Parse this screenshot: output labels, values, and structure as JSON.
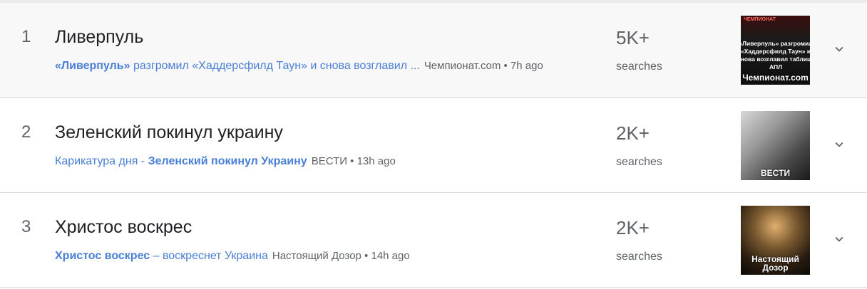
{
  "trends": [
    {
      "rank": "1",
      "title": "Ливерпуль",
      "link_bold": "«Ливерпуль»",
      "link_rest": " разгромил «Хаддерсфилд Таун» и снова возглавил ...",
      "source_time": "Чемпионат.com • 7h ago",
      "count": "5K+",
      "count_label": "searches",
      "thumb_caption": "Чемпионат.com",
      "thumb_small_top": "ЧЕМПИОНАТ",
      "thumb_small_text": "«Ливерпуль» разгромил «Хаддерсфилд Таун» и снова возглавил таблицу АПЛ"
    },
    {
      "rank": "2",
      "title": "Зеленский покинул украину",
      "link_pre": "Карикатура дня - ",
      "link_bold": "Зеленский покинул Украину",
      "source_time": "ВЕСТИ • 13h ago",
      "count": "2K+",
      "count_label": "searches",
      "thumb_caption": "ВЕСТИ"
    },
    {
      "rank": "3",
      "title": "Христос воскрес",
      "link_bold": "Христос воскрес",
      "link_rest": " – воскреснет Украина",
      "source_time": "Настоящий Дозор • 14h ago",
      "count": "2K+",
      "count_label": "searches",
      "thumb_caption": "Настоящий Дозор"
    }
  ],
  "icons": {
    "expand": "chevron-down-icon"
  },
  "colors": {
    "link": "#4a7fd6",
    "muted": "#5f6368",
    "highlight_row": "#f8f8f8"
  }
}
